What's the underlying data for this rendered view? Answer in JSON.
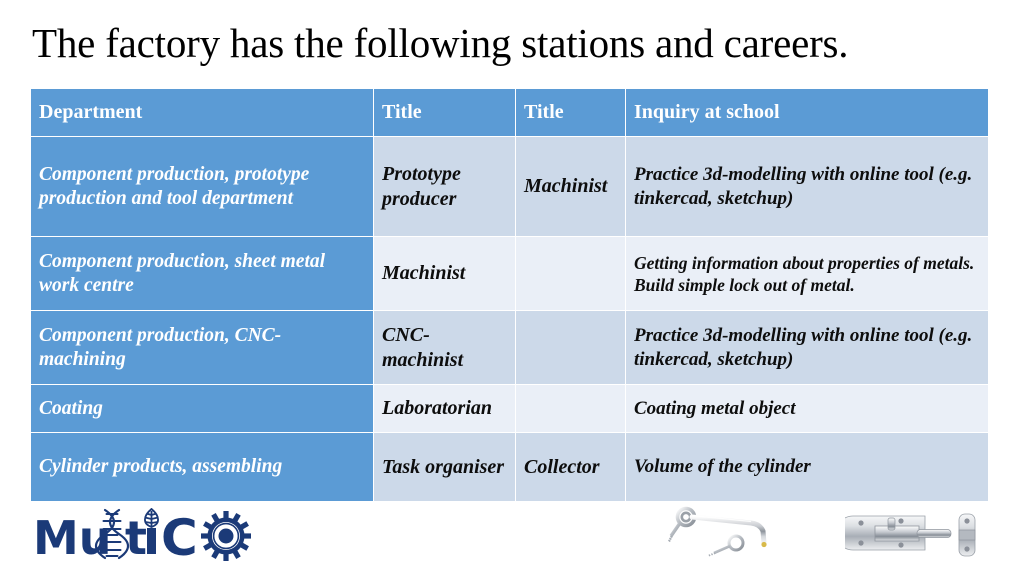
{
  "slide": {
    "title": "The factory has the following stations and careers."
  },
  "table": {
    "headers": [
      "Department",
      "Title",
      "Title",
      "Inquiry at school"
    ],
    "rows": [
      {
        "department": "Component production, prototype production and tool department",
        "title1": "Prototype producer",
        "title2": "Machinist",
        "inquiry": "Practice 3d-modelling with online tool (e.g. tinkercad, sketchup)"
      },
      {
        "department": "Component production, sheet metal work centre",
        "title1": "Machinist",
        "title2": "",
        "inquiry": "Getting information about properties of metals. Build simple lock out of metal."
      },
      {
        "department": "Component production, CNC-machining",
        "title1": "CNC-machinist",
        "title2": "",
        "inquiry": "Practice 3d-modelling with online tool (e.g. tinkercad, sketchup)"
      },
      {
        "department": "Coating",
        "title1": "Laboratorian",
        "title2": "",
        "inquiry": "Coating metal object"
      },
      {
        "department": "Cylinder products, assembling",
        "title1": "Task organiser",
        "title2": "Collector",
        "inquiry": "Volume of the cylinder"
      }
    ]
  },
  "footer": {
    "logo_text": "MultiCO",
    "logo_color": "#1b3a78",
    "logo_icons": [
      "dna-helix-icon",
      "leaf-icon",
      "gear-icon"
    ],
    "images": [
      "gate-hook-latch-photo",
      "barrel-bolt-lock-photo"
    ]
  },
  "colors": {
    "header_blue": "#5b9bd5",
    "band_dark": "#ccd9e9",
    "band_light": "#eaeff7",
    "text_dark": "#0d0d0d",
    "text_light": "#ffffff"
  }
}
